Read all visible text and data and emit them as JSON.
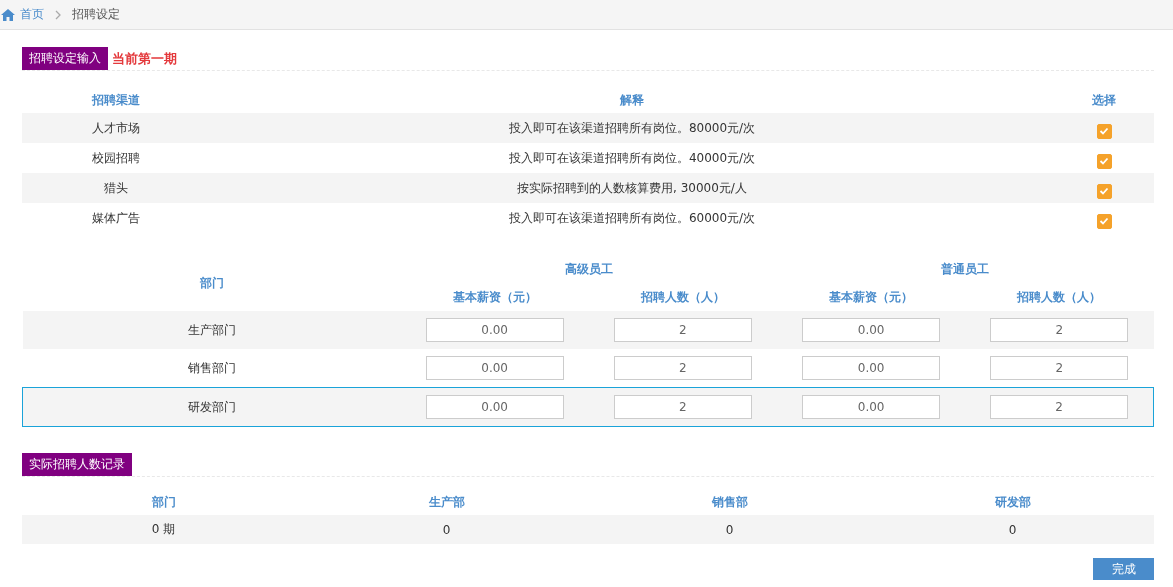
{
  "breadcrumb": {
    "home": "首页",
    "current": "招聘设定"
  },
  "settings": {
    "title": "招聘设定输入",
    "period": "当前第一期",
    "columns": [
      "招聘渠道",
      "解释",
      "选择"
    ],
    "channels": [
      {
        "name": "人才市场",
        "description": "投入即可在该渠道招聘所有岗位。80000元/次",
        "checked": true
      },
      {
        "name": "校园招聘",
        "description": "投入即可在该渠道招聘所有岗位。40000元/次",
        "checked": true
      },
      {
        "name": "猎头",
        "description": "按实际招聘到的人数核算费用, 30000元/人",
        "checked": true
      },
      {
        "name": "媒体广告",
        "description": "投入即可在该渠道招聘所有岗位。60000元/次",
        "checked": true
      }
    ]
  },
  "departments": {
    "dept_column": "部门",
    "groups": [
      "高级员工",
      "普通员工"
    ],
    "subcolumns": [
      "基本薪资（元）",
      "招聘人数（人）",
      "基本薪资（元）",
      "招聘人数（人）"
    ],
    "rows": [
      {
        "name": "生产部门",
        "values": [
          "0.00",
          "2",
          "0.00",
          "2"
        ],
        "selected": false
      },
      {
        "name": "销售部门",
        "values": [
          "0.00",
          "2",
          "0.00",
          "2"
        ],
        "selected": false
      },
      {
        "name": "研发部门",
        "values": [
          "0.00",
          "2",
          "0.00",
          "2"
        ],
        "selected": true
      }
    ]
  },
  "record": {
    "title": "实际招聘人数记录",
    "columns": [
      "部门",
      "生产部",
      "销售部",
      "研发部"
    ],
    "rows": [
      [
        "0 期",
        "0",
        "0",
        "0"
      ]
    ]
  },
  "finish_button": "完成"
}
